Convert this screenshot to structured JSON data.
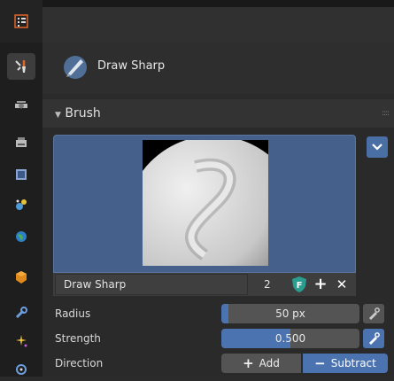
{
  "tool": {
    "name": "Draw Sharp"
  },
  "panel": {
    "title": "Brush",
    "grip": "::::"
  },
  "brush": {
    "name": "Draw Sharp",
    "user_count": "2",
    "fake_user_letter": "F",
    "add_symbol": "+",
    "remove_symbol": "✕"
  },
  "properties": {
    "radius": {
      "label": "Radius",
      "value": "50 px",
      "fraction": 0.05
    },
    "strength": {
      "label": "Strength",
      "value": "0.500",
      "fraction": 0.5
    },
    "direction": {
      "label": "Direction",
      "options": [
        {
          "symbol": "+",
          "label": "Add",
          "active": false
        },
        {
          "symbol": "−",
          "label": "Subtract",
          "active": true
        }
      ]
    }
  },
  "colors": {
    "accent": "#4b73b0",
    "preview_bg": "#45608a",
    "fake_user": "#2a9d8f"
  },
  "sidebar_tabs": [
    "tool-settings-icon",
    "render-icon",
    "output-icon",
    "view-layer-icon",
    "scene-icon",
    "world-icon",
    "object-icon",
    "modifier-icon",
    "particles-icon",
    "physics-icon"
  ]
}
